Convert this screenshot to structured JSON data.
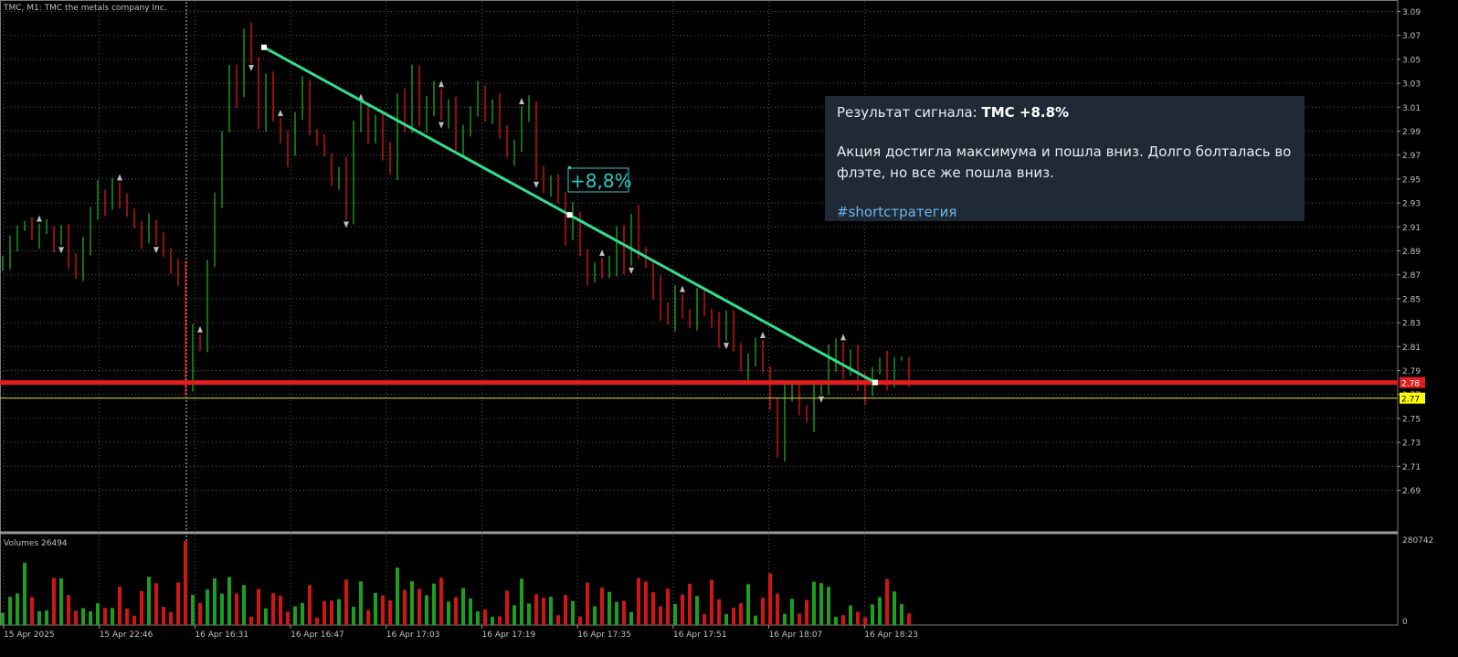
{
  "chart_header": "TMC, M1:  TMC the metals company Inc.",
  "volume_header": "Volumes 26494",
  "signal_annotation": "+8,8%",
  "signal_card": {
    "result_label": "Результат сигнала:",
    "result_value": "TMC +8.8%",
    "body_line1": "Акция достигла максимума и пошла вниз. Долго болталась во",
    "body_line2": "флэте, но все же пошла вниз.",
    "hashtag": "#shortстратегия"
  },
  "colors": {
    "background": "#000000",
    "bull_candle": "#1e9e1e",
    "bear_candle": "#d01515",
    "trend_line": "#2ee08e",
    "support_line": "#e01e1e",
    "bid_line": "#c8c832",
    "annotation": "#2ec8c8",
    "grid": "#5a5a5a",
    "axis_text": "#c0c0c0",
    "card_bg": "#1f2a36",
    "hashtag": "#6fb3ea"
  },
  "chart_data": {
    "type": "line",
    "title": "TMC, M1:  TMC the metals company Inc.",
    "ylim": [
      2.67,
      3.1
    ],
    "y_ticks": [
      "3.09",
      "3.07",
      "3.05",
      "3.03",
      "3.01",
      "2.99",
      "2.97",
      "2.95",
      "2.93",
      "2.91",
      "2.89",
      "2.87",
      "2.85",
      "2.83",
      "2.81",
      "2.79",
      "2.77",
      "2.75",
      "2.73",
      "2.71",
      "2.69"
    ],
    "x_ticks": [
      "15 Apr 2025",
      "15 Apr 22:46",
      "16 Apr 16:31",
      "16 Apr 16:47",
      "16 Apr 17:03",
      "16 Apr 17:19",
      "16 Apr 17:35",
      "16 Apr 17:51",
      "16 Apr 18:07",
      "16 Apr 18:23"
    ],
    "price_labels": [
      {
        "value": 2.78,
        "text": "2.78",
        "color": "#e01e1e"
      },
      {
        "value": 2.77,
        "text": "2.77",
        "color": "#ffff00"
      }
    ],
    "horizontal_levels": [
      {
        "name": "support",
        "value": 2.78
      },
      {
        "name": "bid",
        "value": 2.77
      }
    ],
    "trend_line": {
      "from": {
        "x": "16 Apr 16:33",
        "y": 3.06
      },
      "to": {
        "x": "16 Apr 18:15",
        "y": 2.78
      }
    },
    "close_series": [
      2.88,
      2.9,
      2.91,
      2.91,
      2.9,
      2.91,
      2.91,
      2.9,
      2.91,
      2.88,
      2.87,
      2.89,
      2.92,
      2.94,
      2.93,
      2.94,
      2.93,
      2.92,
      2.91,
      2.9,
      2.91,
      2.9,
      2.89,
      2.88,
      2.87,
      2.78,
      2.82,
      2.81,
      2.88,
      2.93,
      2.99,
      3.04,
      3.02,
      3.07,
      3.05,
      3.0,
      3.03,
      3.0,
      2.98,
      2.97,
      3.0,
      3.03,
      2.99,
      2.98,
      2.97,
      2.95,
      2.96,
      2.92,
      2.99,
      3.01,
      2.98,
      3.0,
      2.97,
      2.96,
      3.02,
      3.0,
      3.04,
      3.0,
      3.01,
      3.02,
      3.0,
      3.01,
      2.98,
      2.99,
      3.01,
      3.02,
      3.0,
      3.01,
      2.99,
      2.97,
      2.98,
      3.0,
      3.01,
      2.96,
      2.94,
      2.95,
      2.93,
      2.9,
      2.92,
      2.89,
      2.87,
      2.88,
      2.87,
      2.88,
      2.9,
      2.88,
      2.92,
      2.89,
      2.88,
      2.86,
      2.84,
      2.83,
      2.85,
      2.84,
      2.83,
      2.85,
      2.84,
      2.83,
      2.82,
      2.83,
      2.81,
      2.79,
      2.8,
      2.81,
      2.79,
      2.76,
      2.72,
      2.77,
      2.78,
      2.76,
      2.75,
      2.77,
      2.78,
      2.8,
      2.81,
      2.79,
      2.8,
      2.78,
      2.77,
      2.79,
      2.8,
      2.78,
      2.8,
      2.8,
      2.78
    ],
    "volume_ylim": [
      0,
      280742
    ],
    "volume_label_max": "280742",
    "volume_label_min": "0"
  }
}
